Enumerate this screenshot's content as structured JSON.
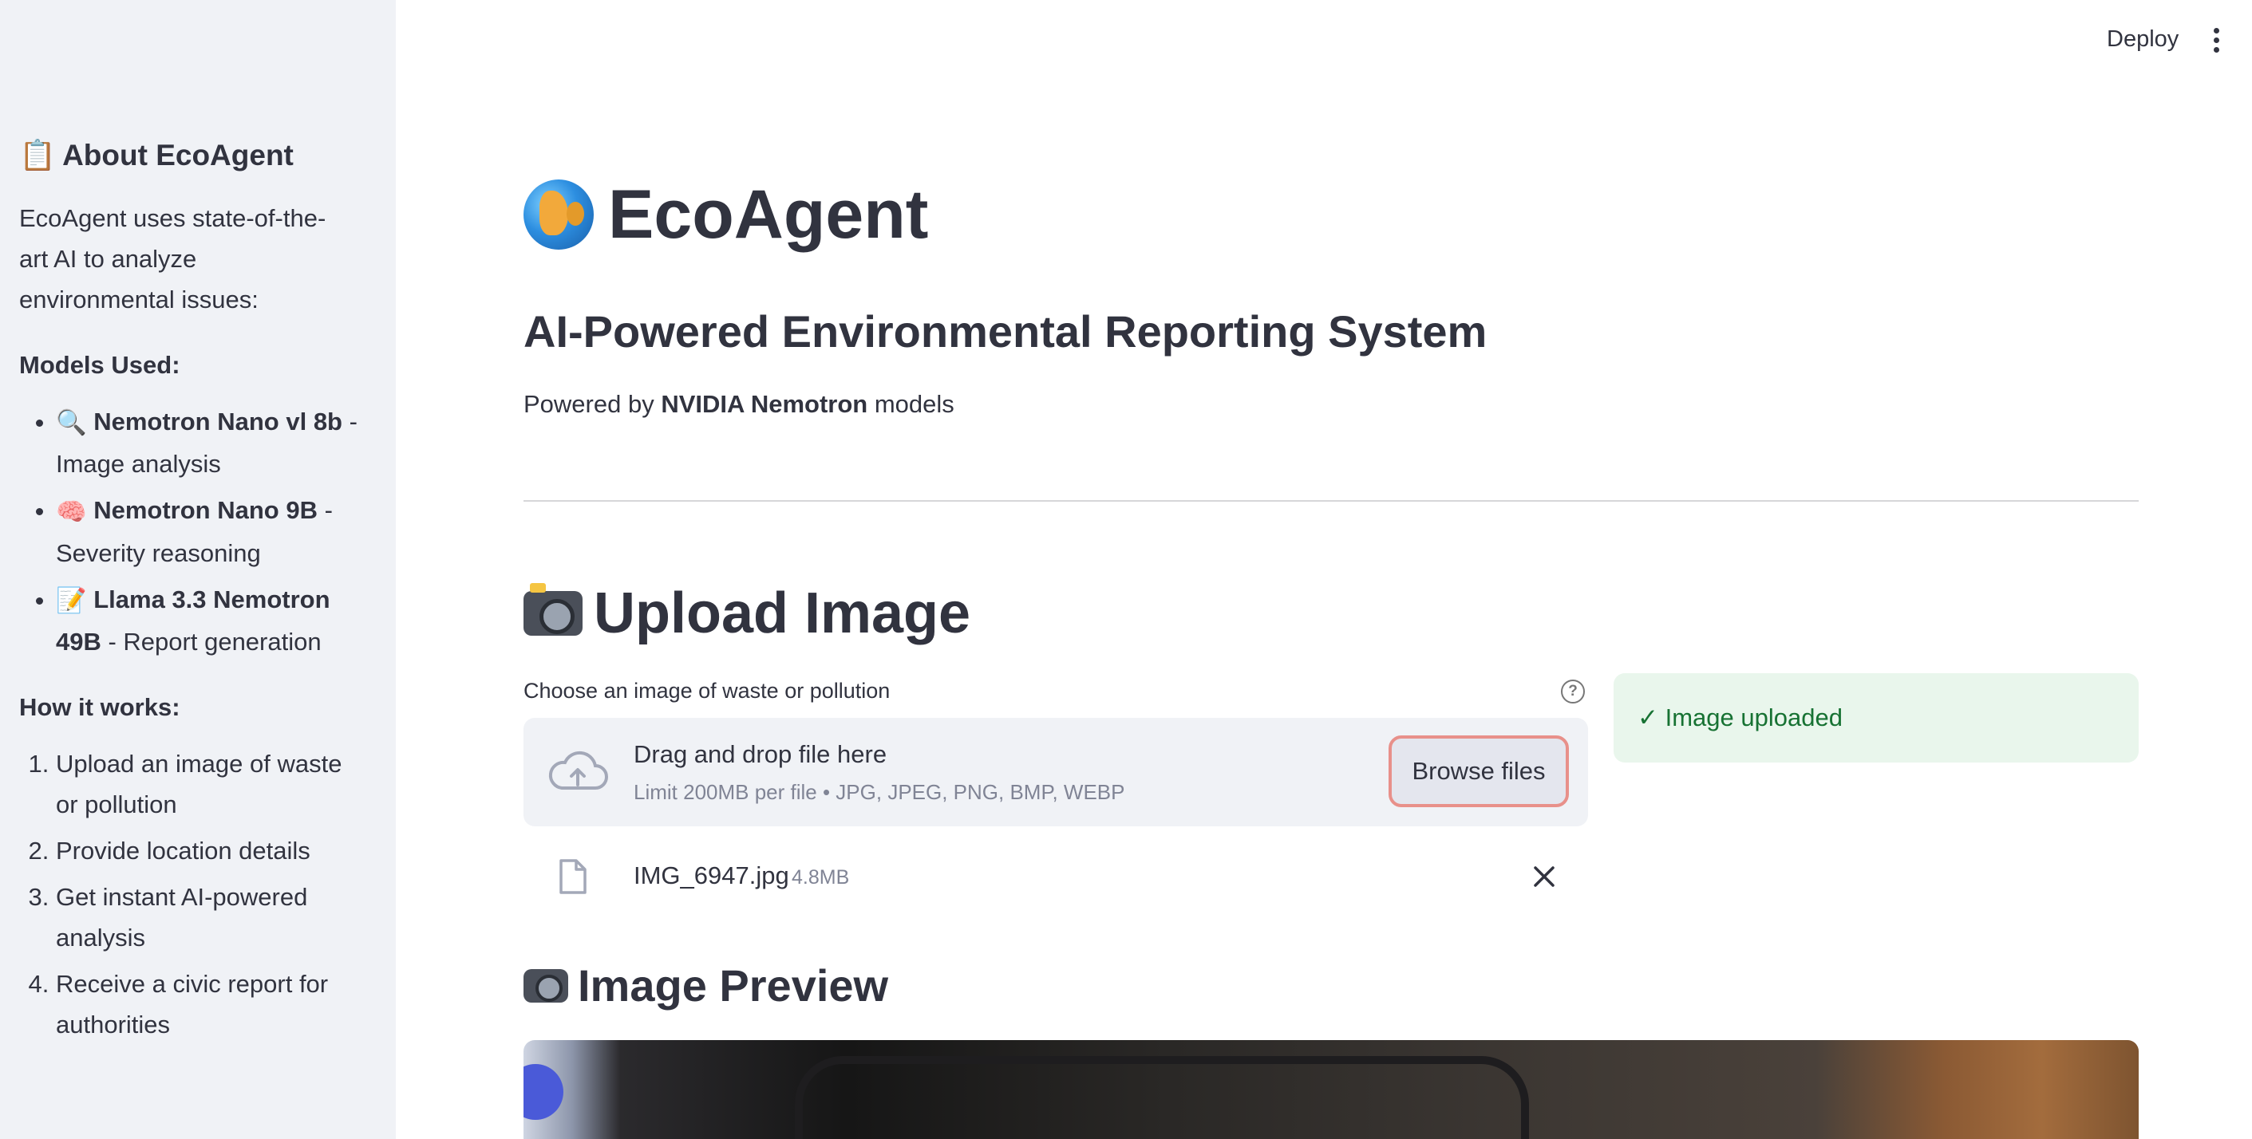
{
  "header": {
    "deploy_label": "Deploy"
  },
  "sidebar": {
    "title_emoji": "📋",
    "title": "About EcoAgent",
    "intro": "EcoAgent uses state-of-the-art AI to analyze environmental issues:",
    "models_heading": "Models Used:",
    "models": [
      {
        "emoji": "🔍",
        "name": "Nemotron Nano vl 8b",
        "desc": " - Image analysis"
      },
      {
        "emoji": "🧠",
        "name": "Nemotron Nano 9B",
        "desc": " - Severity reasoning"
      },
      {
        "emoji": "📝",
        "name": "Llama 3.3 Nemotron 49B",
        "desc": " - Report generation"
      }
    ],
    "how_heading": "How it works:",
    "steps": [
      "Upload an image of waste or pollution",
      "Provide location details",
      "Get instant AI-powered analysis",
      "Receive a civic report for authorities"
    ]
  },
  "main": {
    "title": "EcoAgent",
    "subtitle": "AI-Powered Environmental Reporting System",
    "powered_prefix": "Powered by ",
    "powered_brand": "NVIDIA Nemotron",
    "powered_suffix": " models",
    "upload_heading": "Upload Image",
    "uploader": {
      "label": "Choose an image of waste or pollution",
      "help": "?",
      "drop_title": "Drag and drop file here",
      "limit": "Limit 200MB per file • JPG, JPEG, PNG, BMP, WEBP",
      "browse_label": "Browse files",
      "file": {
        "name": "IMG_6947.jpg",
        "size": "4.8MB"
      }
    },
    "success_message": "✓ Image uploaded",
    "preview_heading": "Image Preview"
  },
  "colors": {
    "sidebar_bg": "#f0f2f6",
    "text": "#31333f",
    "success_bg": "#e9f6ec",
    "success_text": "#177233",
    "browse_focus": "#e8908a"
  }
}
